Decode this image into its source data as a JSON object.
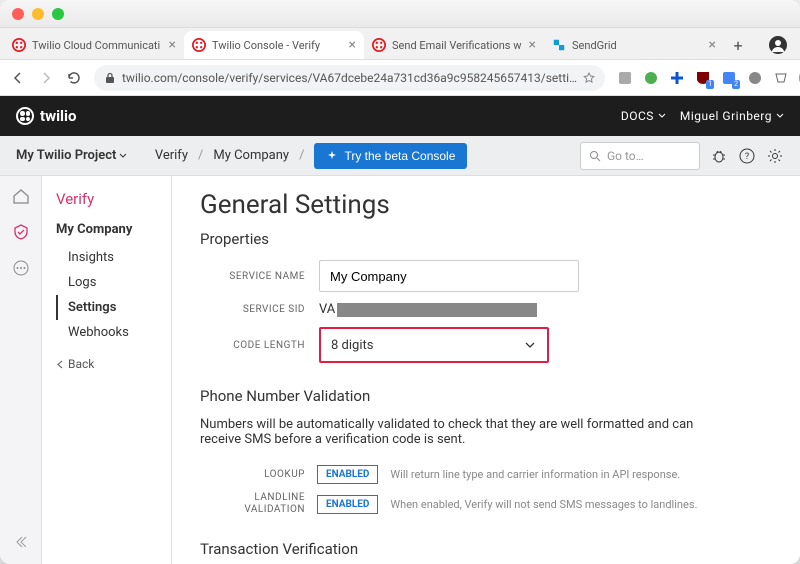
{
  "browser": {
    "tabs": [
      {
        "title": "Twilio Cloud Communicati",
        "favicon": "red"
      },
      {
        "title": "Twilio Console - Verify",
        "favicon": "red",
        "active": true
      },
      {
        "title": "Send Email Verifications w",
        "favicon": "red"
      },
      {
        "title": "SendGrid",
        "favicon": "blue"
      }
    ],
    "url": "twilio.com/console/verify/services/VA67dcebe24a731cd36a9c958245657413/setti…"
  },
  "topnav": {
    "docs": "DOCS",
    "user": "Miguel Grinberg"
  },
  "subheader": {
    "project": "My Twilio Project",
    "crumbs": [
      "Verify",
      "My Company"
    ],
    "beta_button": "Try the beta Console",
    "search_placeholder": "Go to…"
  },
  "sidebar": {
    "title": "Verify",
    "heading": "My Company",
    "items": [
      {
        "label": "Insights"
      },
      {
        "label": "Logs"
      },
      {
        "label": "Settings",
        "active": true
      },
      {
        "label": "Webhooks"
      }
    ],
    "back": "Back"
  },
  "content": {
    "heading": "General Settings",
    "properties": {
      "section_title": "Properties",
      "service_name_label": "SERVICE NAME",
      "service_name_value": "My Company",
      "service_sid_label": "SERVICE SID",
      "service_sid_prefix": "VA",
      "code_length_label": "CODE LENGTH",
      "code_length_value": "8 digits"
    },
    "phone_validation": {
      "section_title": "Phone Number Validation",
      "description": "Numbers will be automatically validated to check that they are well formatted and can receive SMS before a verification code is sent.",
      "lookup_label": "LOOKUP",
      "lookup_state": "ENABLED",
      "lookup_desc": "Will return line type and carrier information in API response.",
      "landline_label": "LANDLINE VALIDATION",
      "landline_state": "ENABLED",
      "landline_desc": "When enabled, Verify will not send SMS messages to landlines."
    },
    "transaction": {
      "section_title": "Transaction Verification"
    }
  }
}
